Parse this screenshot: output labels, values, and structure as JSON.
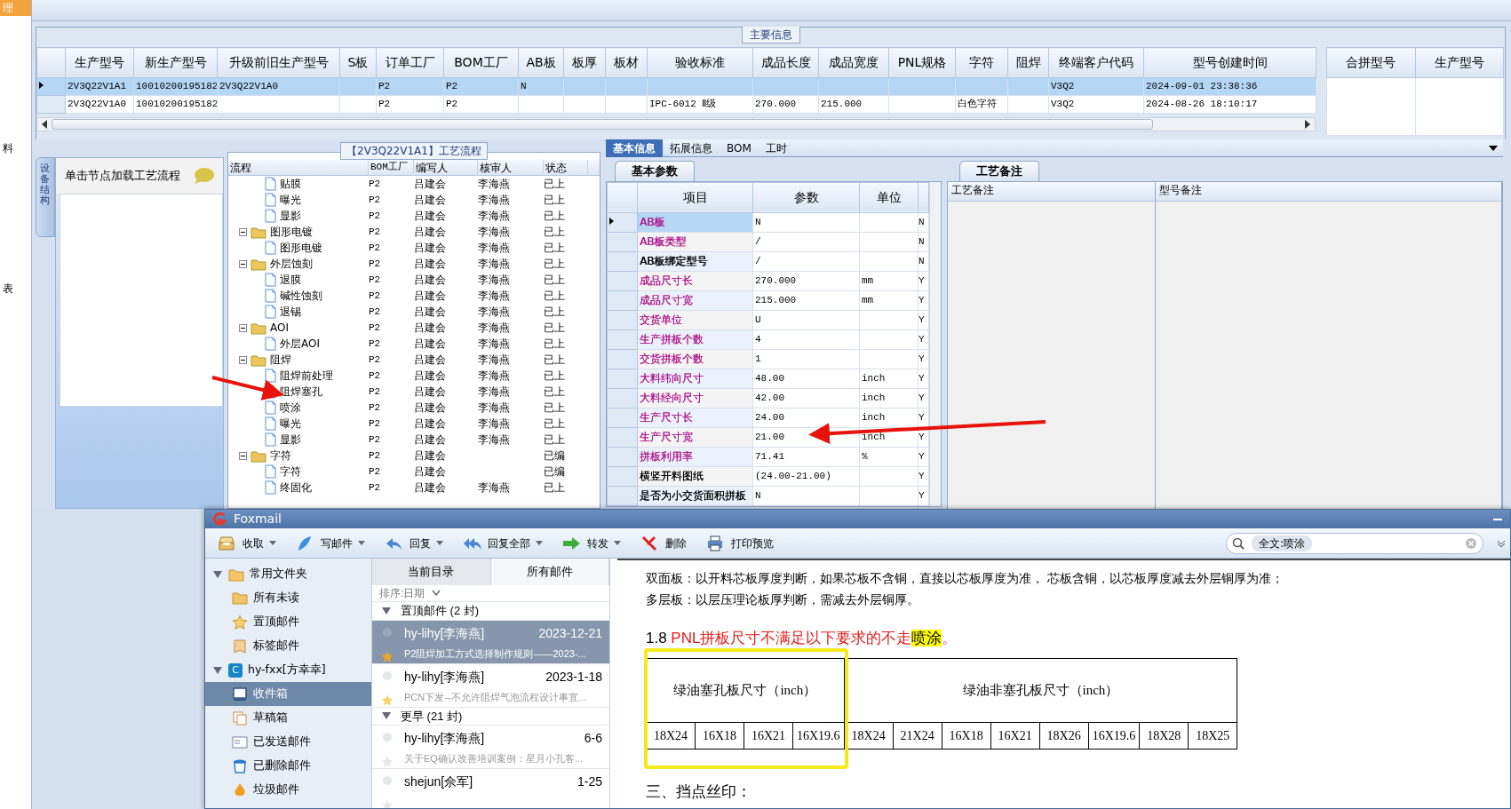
{
  "sidebar": {
    "items": [
      {
        "label": "理",
        "selected": true
      },
      {
        "label": "料",
        "selected": false
      },
      {
        "label": "表",
        "selected": false
      }
    ]
  },
  "main_info": {
    "title": "主要信息",
    "columns": [
      "生产型号",
      "新生产型号",
      "升级前旧生产型号",
      "S板",
      "订单工厂",
      "BOM工厂",
      "AB板",
      "板厚",
      "板材",
      "验收标准",
      "成品长度",
      "成品宽度",
      "PNL规格",
      "字符",
      "阻焊",
      "终端客户代码",
      "型号创建时间"
    ],
    "rows": [
      {
        "selected": true,
        "cells": [
          "2V3Q22V1A1",
          "10010200195182",
          "2V3Q22V1A0",
          null,
          "P2",
          "P2",
          "N",
          null,
          null,
          null,
          null,
          null,
          null,
          null,
          null,
          "V3Q2",
          "2024-09-01 23:38:36"
        ]
      },
      {
        "selected": false,
        "cells": [
          "2V3Q22V1A0",
          "10010200195182",
          null,
          null,
          "P2",
          "P2",
          null,
          null,
          null,
          "IPC-6012 Ⅱ级",
          "270.000",
          "215.000",
          null,
          "白色字符",
          null,
          "V3Q2",
          "2024-08-26 18:10:17"
        ]
      }
    ],
    "side_columns": [
      "合拼型号",
      "生产型号"
    ]
  },
  "process": {
    "side_tab": "设备结构",
    "hint": "单击节点加载工艺流程",
    "title": "【2V3Q22V1A1】工艺流程",
    "columns": [
      "流程",
      "BOM工厂",
      "编写人",
      "核审人",
      "状态"
    ],
    "tree": [
      {
        "kind": "continued",
        "children": [
          {
            "kind": "file",
            "label": "贴膜",
            "factory": "P2",
            "writer": "吕建会",
            "reviewer": "李海燕",
            "status": "已上"
          },
          {
            "kind": "file",
            "label": "曝光",
            "factory": "P2",
            "writer": "吕建会",
            "reviewer": "李海燕",
            "status": "已上"
          },
          {
            "kind": "file",
            "label": "显影",
            "factory": "P2",
            "writer": "吕建会",
            "reviewer": "李海燕",
            "status": "已上"
          }
        ]
      },
      {
        "kind": "folder",
        "expanded": true,
        "label": "图形电镀",
        "factory": "P2",
        "writer": "吕建会",
        "reviewer": "李海燕",
        "status": "已上",
        "children": [
          {
            "kind": "file",
            "label": "图形电镀",
            "factory": "P2",
            "writer": "吕建会",
            "reviewer": "李海燕",
            "status": "已上"
          }
        ]
      },
      {
        "kind": "folder",
        "expanded": true,
        "label": "外层蚀刻",
        "factory": "P2",
        "writer": "吕建会",
        "reviewer": "李海燕",
        "status": "已上",
        "children": [
          {
            "kind": "file",
            "label": "退膜",
            "factory": "P2",
            "writer": "吕建会",
            "reviewer": "李海燕",
            "status": "已上"
          },
          {
            "kind": "file",
            "label": "碱性蚀刻",
            "factory": "P2",
            "writer": "吕建会",
            "reviewer": "李海燕",
            "status": "已上"
          },
          {
            "kind": "file",
            "label": "退锡",
            "factory": "P2",
            "writer": "吕建会",
            "reviewer": "李海燕",
            "status": "已上"
          }
        ]
      },
      {
        "kind": "folder",
        "expanded": true,
        "label": "AOI",
        "factory": "P2",
        "writer": "吕建会",
        "reviewer": "李海燕",
        "status": "已上",
        "children": [
          {
            "kind": "file",
            "label": "外层AOI",
            "factory": "P2",
            "writer": "吕建会",
            "reviewer": "李海燕",
            "status": "已上"
          }
        ]
      },
      {
        "kind": "folder",
        "expanded": true,
        "label": "阻焊",
        "factory": "P2",
        "writer": "吕建会",
        "reviewer": "李海燕",
        "status": "已上",
        "children": [
          {
            "kind": "file",
            "label": "阻焊前处理",
            "factory": "P2",
            "writer": "吕建会",
            "reviewer": "李海燕",
            "status": "已上"
          },
          {
            "kind": "file",
            "label": "阻焊塞孔",
            "factory": "P2",
            "writer": "吕建会",
            "reviewer": "李海燕",
            "status": "已上"
          },
          {
            "kind": "file",
            "label": "喷涂",
            "factory": "P2",
            "writer": "吕建会",
            "reviewer": "李海燕",
            "status": "已上"
          },
          {
            "kind": "file",
            "label": "曝光",
            "factory": "P2",
            "writer": "吕建会",
            "reviewer": "李海燕",
            "status": "已上"
          },
          {
            "kind": "file",
            "label": "显影",
            "factory": "P2",
            "writer": "吕建会",
            "reviewer": "李海燕",
            "status": "已上"
          }
        ]
      },
      {
        "kind": "folder",
        "expanded": true,
        "label": "字符",
        "factory": "P2",
        "writer": "吕建会",
        "status": "已编",
        "children": [
          {
            "kind": "file",
            "label": "字符",
            "factory": "P2",
            "writer": "吕建会",
            "status": "已编"
          },
          {
            "kind": "file",
            "label": "终固化",
            "factory": "P2",
            "writer": "吕建会",
            "reviewer": "李海燕",
            "status": "已上"
          }
        ]
      }
    ]
  },
  "detail_tabs": [
    {
      "label": "基本信息",
      "selected": true
    },
    {
      "label": "拓展信息",
      "selected": false
    },
    {
      "label": "BOM",
      "selected": false
    },
    {
      "label": "工时",
      "selected": false
    }
  ],
  "basic_params": {
    "tab": "基本参数",
    "columns": [
      "项目",
      "参数",
      "单位"
    ],
    "rows": [
      {
        "item": "AB板",
        "value": "N",
        "column_4": "N",
        "color": "#b0178c",
        "selected": true
      },
      {
        "item": "AB板类型",
        "value": "/",
        "column_4": "N",
        "color": "#b0178c",
        "selected": false
      },
      {
        "item": "AB板绑定型号",
        "value": "/",
        "column_4": "N",
        "color": "#000000",
        "selected": false
      },
      {
        "item": "成品尺寸长",
        "value": "270.000",
        "unit": "mm",
        "column_4": "Y",
        "color": "#b0178c",
        "selected": false
      },
      {
        "item": "成品尺寸宽",
        "value": "215.000",
        "unit": "mm",
        "column_4": "Y",
        "color": "#b0178c",
        "selected": false
      },
      {
        "item": "交货单位",
        "value": "U",
        "column_4": "Y",
        "color": "#b0178c",
        "selected": false
      },
      {
        "item": "生产拼板个数",
        "value": "4",
        "column_4": "Y",
        "color": "#b0178c",
        "selected": false
      },
      {
        "item": "交货拼板个数",
        "value": "1",
        "column_4": "Y",
        "color": "#b0178c",
        "selected": false
      },
      {
        "item": "大料纬向尺寸",
        "value": "48.00",
        "unit": "inch",
        "column_4": "Y",
        "color": "#b0178c",
        "selected": false
      },
      {
        "item": "大料经向尺寸",
        "value": "42.00",
        "unit": "inch",
        "column_4": "Y",
        "color": "#b0178c",
        "selected": false
      },
      {
        "item": "生产尺寸长",
        "value": "24.00",
        "unit": "inch",
        "column_4": "Y",
        "color": "#b0178c",
        "selected": false
      },
      {
        "item": "生产尺寸宽",
        "value": "21.00",
        "unit": "inch",
        "column_4": "Y",
        "color": "#b0178c",
        "selected": false
      },
      {
        "item": "拼板利用率",
        "value": "71.41",
        "unit": "%",
        "column_4": "Y",
        "color": "#b0178c",
        "selected": false
      },
      {
        "item": "横竖开料图纸",
        "value": "(24.00-21.00)",
        "column_4": "Y",
        "color": "#000000",
        "selected": false
      },
      {
        "item": "是否为小交货面积拼板",
        "value": "N",
        "column_4": "Y",
        "color": "#000000",
        "selected": false
      }
    ]
  },
  "remarks": {
    "tab": "工艺备注",
    "columns": [
      "工艺备注",
      "型号备注"
    ]
  },
  "mail": {
    "title": "Foxmail",
    "toolbar": [
      {
        "kind": "receive",
        "label": "收取",
        "dropdown": true
      },
      {
        "kind": "compose",
        "label": "写邮件",
        "dropdown": true
      },
      {
        "kind": "reply",
        "label": "回复",
        "dropdown": true
      },
      {
        "kind": "reply_all",
        "label": "回复全部",
        "dropdown": true
      },
      {
        "kind": "forward",
        "label": "转发",
        "dropdown": true
      },
      {
        "kind": "delete",
        "label": "删除",
        "dropdown": false
      },
      {
        "kind": "print",
        "label": "打印预览",
        "dropdown": false
      }
    ],
    "search": {
      "token": "全文:喷涂"
    },
    "folders": [
      {
        "kind": "group",
        "label": "常用文件夹",
        "expanded": true,
        "children": [
          {
            "kind": "unread",
            "label": "所有未读",
            "selected": false
          },
          {
            "kind": "pinned",
            "label": "置顶邮件",
            "selected": false
          },
          {
            "kind": "tagged",
            "label": "标签邮件",
            "selected": false
          }
        ]
      },
      {
        "kind": "account",
        "label": "hy-fxx[方幸幸]",
        "badge": "C",
        "expanded": true,
        "children": [
          {
            "kind": "inbox",
            "label": "收件箱",
            "selected": true
          },
          {
            "kind": "drafts",
            "label": "草稿箱",
            "selected": false
          },
          {
            "kind": "sent",
            "label": "已发送邮件",
            "selected": false
          },
          {
            "kind": "trash",
            "label": "已删除邮件",
            "selected": false
          },
          {
            "kind": "spam",
            "label": "垃圾邮件",
            "selected": false
          }
        ]
      }
    ],
    "list_tabs": [
      {
        "label": "当前目录",
        "selected": true
      },
      {
        "label": "所有邮件",
        "selected": false
      }
    ],
    "sort": "排序:日期",
    "groups": [
      {
        "title": "置顶邮件 (2 封)",
        "expanded": true,
        "messages": [
          {
            "sender": "hy-lihy[李海燕]",
            "date": "2023-12-21",
            "subject": "P2阻焊加工方式选择制作规则——2023-...",
            "starred": true,
            "selected": true
          },
          {
            "sender": "hy-lihy[李海燕]",
            "date": "2023-1-18",
            "subject": "PCN下发--不允许阻焊气泡流程设计事宜...",
            "starred": true,
            "selected": false
          }
        ]
      },
      {
        "title": "更早 (21 封)",
        "expanded": true,
        "messages": [
          {
            "sender": "hy-lihy[李海燕]",
            "date": "6-6",
            "subject": "关于EQ确认改善培训案例：星月小孔客...",
            "starred": false,
            "selected": false
          },
          {
            "sender": "shejun[佘军]",
            "date": "1-25",
            "starred": false,
            "selected": false
          }
        ]
      }
    ],
    "body": {
      "paragraphs": [
        "双面板：以开料芯板厚度判断，如果芯板不含铜，直接以芯板厚度为准， 芯板含铜，以芯板厚度减去外层铜厚为准；",
        "多层板：以层压理论板厚判断，需减去外层铜厚。"
      ],
      "heading": [
        {
          "kind": "plain",
          "text": "1.8 "
        },
        {
          "kind": "red",
          "text": "PNL拼板尺寸不满足以下要求的不走"
        },
        {
          "kind": "highlight",
          "text": "喷涂"
        },
        {
          "kind": "red",
          "text": "。"
        }
      ],
      "table": {
        "groups": [
          {
            "label": "绿油塞孔板尺寸（inch）",
            "sizes": [
              "18X24",
              "16X18",
              "16X21",
              "16X19.6"
            ]
          },
          {
            "label": "绿油非塞孔板尺寸（inch）",
            "sizes": [
              "18X24",
              "21X24",
              "16X18",
              "16X21",
              "18X26",
              "16X19.6",
              "18X28",
              "18X25"
            ]
          }
        ]
      },
      "section": "三、挡点丝印："
    }
  }
}
